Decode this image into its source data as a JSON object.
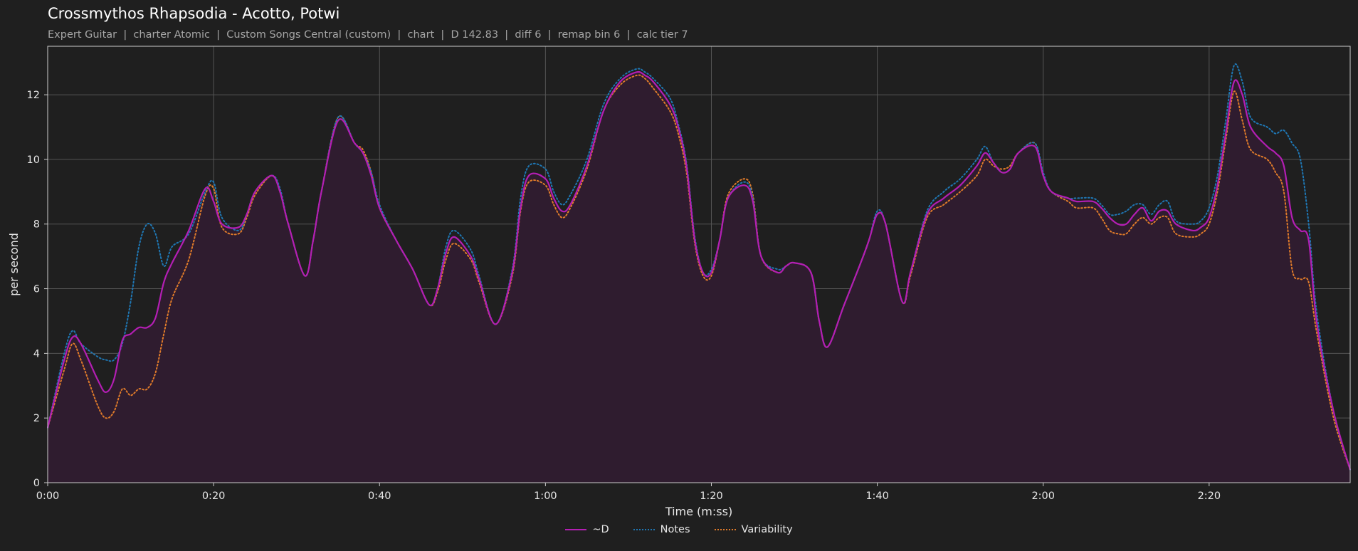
{
  "header": {
    "title": "Crossmythos Rhapsodia - Acotto, Potwi",
    "subtitle": "Expert Guitar  |  charter Atomic  |  Custom Songs Central (custom)  |  chart  |  D 142.83  |  diff 6  |  remap bin 6  |  calc tier 7"
  },
  "chart_data": {
    "type": "line",
    "title": "Crossmythos Rhapsodia - Acotto, Potwi",
    "xlabel": "Time (m:ss)",
    "ylabel": "per second",
    "xlim": [
      0,
      157
    ],
    "ylim": [
      0,
      13.5
    ],
    "xticks": [
      0,
      20,
      40,
      60,
      80,
      100,
      120,
      140
    ],
    "xtick_labels": [
      "0:00",
      "0:20",
      "0:40",
      "1:00",
      "1:20",
      "1:40",
      "2:00",
      "2:20"
    ],
    "yticks": [
      0,
      2,
      4,
      6,
      8,
      10,
      12
    ],
    "ytick_labels": [
      "0",
      "2",
      "4",
      "6",
      "8",
      "10",
      "12"
    ],
    "grid": true,
    "legend_position": "bottom-center",
    "x": [
      0,
      2,
      3,
      4,
      6,
      7,
      8,
      9,
      10,
      11,
      12,
      13,
      14,
      15,
      17,
      19,
      20,
      21,
      23,
      24,
      25,
      27,
      28,
      29,
      31,
      32,
      33,
      35,
      37,
      38,
      39,
      40,
      42,
      44,
      46,
      47,
      48,
      49,
      51,
      52,
      54,
      56,
      57,
      58,
      60,
      61,
      62,
      63,
      65,
      67,
      69,
      71,
      72,
      73,
      75,
      76,
      77,
      78,
      79,
      80,
      81,
      82,
      84,
      85,
      86,
      88,
      89,
      90,
      92,
      93,
      94,
      96,
      98,
      99,
      100,
      101,
      103,
      104,
      106,
      108,
      110,
      112,
      113,
      114,
      115,
      116,
      117,
      119,
      120,
      121,
      123,
      124,
      126,
      127,
      128,
      129,
      130,
      131,
      132,
      133,
      134,
      135,
      136,
      138,
      139,
      140,
      141,
      142,
      143,
      144,
      145,
      147,
      148,
      149,
      150,
      151,
      152,
      153,
      155,
      157
    ],
    "series": [
      {
        "name": "~D",
        "color": "#b31eb3",
        "style": "solid",
        "filled": true,
        "values": [
          1.7,
          3.8,
          4.5,
          4.3,
          3.2,
          2.8,
          3.2,
          4.4,
          4.6,
          4.8,
          4.8,
          5.1,
          6.2,
          6.8,
          7.8,
          9.1,
          8.7,
          8.0,
          7.9,
          8.3,
          9.0,
          9.5,
          9.0,
          8.0,
          6.4,
          7.5,
          9.0,
          11.2,
          10.5,
          10.2,
          9.5,
          8.5,
          7.5,
          6.6,
          5.5,
          6.0,
          7.1,
          7.6,
          7.0,
          6.3,
          4.9,
          6.5,
          8.5,
          9.5,
          9.4,
          8.8,
          8.4,
          8.6,
          9.8,
          11.5,
          12.4,
          12.7,
          12.6,
          12.4,
          11.7,
          11.0,
          9.8,
          7.5,
          6.5,
          6.5,
          7.5,
          8.8,
          9.2,
          8.7,
          7.0,
          6.5,
          6.7,
          6.8,
          6.5,
          5.0,
          4.2,
          5.5,
          6.8,
          7.5,
          8.3,
          8.0,
          5.6,
          6.5,
          8.3,
          8.8,
          9.2,
          9.8,
          10.2,
          9.9,
          9.6,
          9.7,
          10.2,
          10.4,
          9.5,
          9.0,
          8.8,
          8.7,
          8.7,
          8.5,
          8.2,
          8.0,
          8.0,
          8.3,
          8.5,
          8.1,
          8.4,
          8.4,
          8.0,
          7.8,
          7.9,
          8.2,
          9.2,
          10.8,
          12.4,
          12.0,
          11.0,
          10.4,
          10.2,
          9.8,
          8.2,
          7.8,
          7.5,
          4.9,
          2.2,
          0.4
        ]
      },
      {
        "name": "Notes",
        "color": "#1f77b4",
        "style": "dotted",
        "filled": false,
        "values": [
          1.7,
          4.0,
          4.7,
          4.3,
          3.9,
          3.8,
          3.8,
          4.3,
          5.6,
          7.3,
          8.0,
          7.7,
          6.7,
          7.3,
          7.7,
          9.0,
          9.3,
          8.2,
          7.8,
          8.3,
          9.0,
          9.5,
          9.1,
          8.0,
          6.4,
          7.5,
          9.0,
          11.3,
          10.5,
          10.2,
          9.6,
          8.6,
          7.5,
          6.6,
          5.5,
          6.0,
          7.3,
          7.8,
          7.2,
          6.4,
          4.9,
          6.6,
          8.8,
          9.8,
          9.7,
          9.0,
          8.6,
          8.9,
          10.0,
          11.7,
          12.5,
          12.8,
          12.7,
          12.5,
          11.9,
          11.1,
          9.9,
          7.6,
          6.5,
          6.6,
          7.5,
          8.8,
          9.3,
          8.8,
          7.0,
          6.6,
          6.7,
          6.8,
          6.5,
          5.0,
          4.2,
          5.5,
          6.8,
          7.5,
          8.4,
          8.0,
          5.6,
          6.5,
          8.4,
          9.0,
          9.4,
          10.0,
          10.4,
          9.9,
          9.6,
          9.7,
          10.2,
          10.5,
          9.6,
          9.0,
          8.8,
          8.8,
          8.8,
          8.6,
          8.3,
          8.3,
          8.4,
          8.6,
          8.6,
          8.3,
          8.6,
          8.7,
          8.1,
          8.0,
          8.1,
          8.5,
          9.5,
          11.2,
          12.9,
          12.4,
          11.3,
          11.0,
          10.8,
          10.9,
          10.5,
          10.0,
          8.0,
          5.2,
          2.2,
          0.4
        ]
      },
      {
        "name": "Variability",
        "color": "#e07b2a",
        "style": "dotted",
        "filled": false,
        "values": [
          1.7,
          3.5,
          4.3,
          3.8,
          2.4,
          2.0,
          2.2,
          2.9,
          2.7,
          2.9,
          2.9,
          3.4,
          4.6,
          5.7,
          6.9,
          8.9,
          9.1,
          7.9,
          7.7,
          8.2,
          8.9,
          9.5,
          9.0,
          8.0,
          6.4,
          7.5,
          9.0,
          11.3,
          10.5,
          10.3,
          9.6,
          8.5,
          7.5,
          6.6,
          5.5,
          5.9,
          6.9,
          7.4,
          6.9,
          6.2,
          4.9,
          6.4,
          8.4,
          9.3,
          9.2,
          8.6,
          8.2,
          8.5,
          9.7,
          11.5,
          12.3,
          12.6,
          12.5,
          12.2,
          11.5,
          10.8,
          9.6,
          7.4,
          6.4,
          6.4,
          7.5,
          8.9,
          9.4,
          8.9,
          7.0,
          6.5,
          6.7,
          6.8,
          6.5,
          5.0,
          4.2,
          5.5,
          6.8,
          7.5,
          8.3,
          8.0,
          5.6,
          6.4,
          8.2,
          8.6,
          9.0,
          9.5,
          10.0,
          9.8,
          9.7,
          9.8,
          10.2,
          10.5,
          9.5,
          9.0,
          8.7,
          8.5,
          8.5,
          8.2,
          7.8,
          7.7,
          7.7,
          8.0,
          8.2,
          8.0,
          8.2,
          8.2,
          7.7,
          7.6,
          7.7,
          8.0,
          9.0,
          10.6,
          12.1,
          11.2,
          10.3,
          10.0,
          9.6,
          9.0,
          6.6,
          6.3,
          6.2,
          4.6,
          2.0,
          0.4
        ]
      }
    ]
  }
}
